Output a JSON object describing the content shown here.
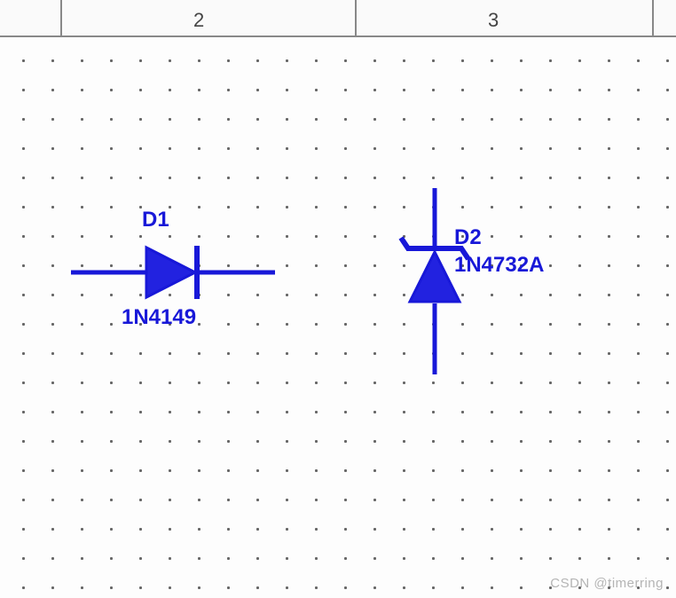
{
  "ruler": {
    "tick_labels": [
      "2",
      "3"
    ]
  },
  "components": {
    "d1": {
      "ref": "D1",
      "value": "1N4149"
    },
    "d2": {
      "ref": "D2",
      "value": "1N4732A"
    }
  },
  "watermark": "CSDN @timerring",
  "colors": {
    "symbol": "#1818d8",
    "fill": "#2222e0"
  }
}
